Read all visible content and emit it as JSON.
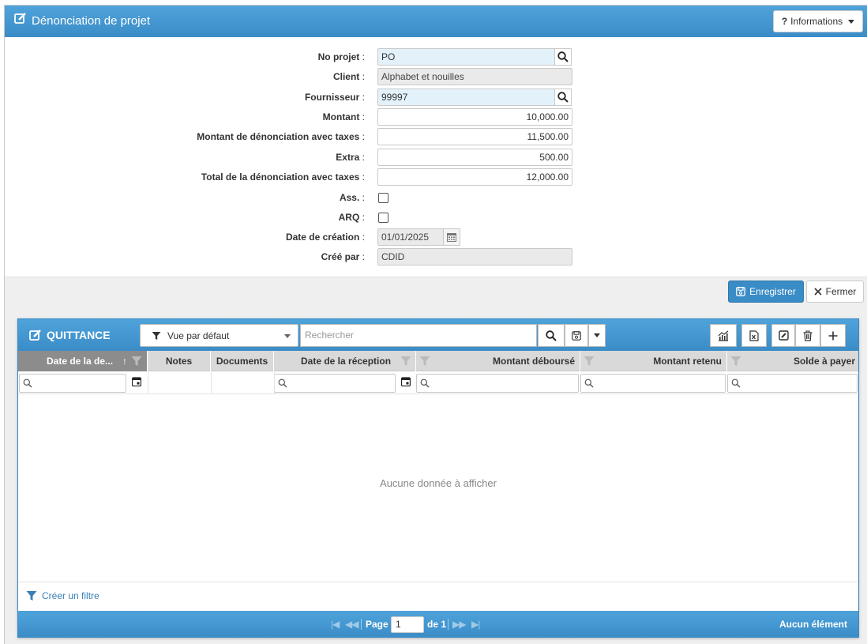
{
  "header": {
    "title": "Dénonciation de projet",
    "info_button": "Informations"
  },
  "form": {
    "no_projet": {
      "label": "No projet",
      "value": "PO"
    },
    "client": {
      "label": "Client",
      "value": "Alphabet et nouilles"
    },
    "fournisseur": {
      "label": "Fournisseur",
      "value": "99997"
    },
    "montant": {
      "label": "Montant",
      "value": "10,000.00"
    },
    "montant_denonciation": {
      "label": "Montant de dénonciation avec taxes",
      "value": "11,500.00"
    },
    "extra": {
      "label": "Extra",
      "value": "500.00"
    },
    "total": {
      "label": "Total de la dénonciation avec taxes",
      "value": "12,000.00"
    },
    "ass": {
      "label": "Ass.",
      "checked": false
    },
    "arq": {
      "label": "ARQ",
      "checked": false
    },
    "date_creation": {
      "label": "Date de création",
      "value": "01/01/2025"
    },
    "cree_par": {
      "label": "Créé par",
      "value": "CDID"
    },
    "colon": ":"
  },
  "actions": {
    "save": "Enregistrer",
    "close": "Fermer"
  },
  "grid": {
    "title": "QUITTANCE",
    "view": "Vue par défaut",
    "search_placeholder": "Rechercher",
    "columns": [
      "Date de la de...",
      "Notes",
      "Documents",
      "Date de la réception",
      "Montant déboursé",
      "Montant retenu",
      "Solde à payer"
    ],
    "empty_message": "Aucune donnée à afficher",
    "create_filter": "Créer un filtre",
    "pager": {
      "page_label": "Page",
      "page_value": "1",
      "of_label": "de 1",
      "total_label": "Aucun élément"
    }
  },
  "colors": {
    "primary": "#3a8cc7",
    "field_highlight": "#e3f1fb",
    "readonly": "#eaeaea"
  }
}
